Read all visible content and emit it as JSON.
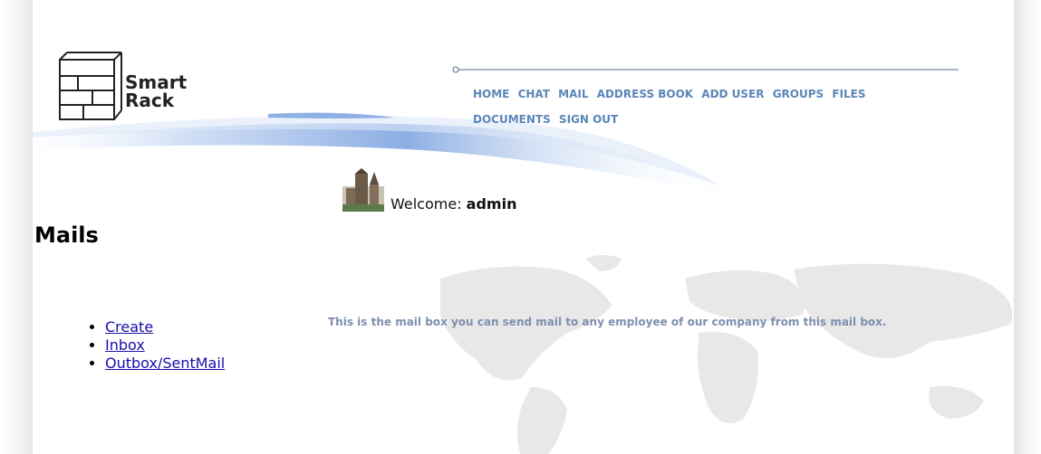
{
  "logo": {
    "line1": "Smart",
    "line2": "Rack"
  },
  "nav": {
    "items": [
      "HOME",
      "CHAT",
      "MAIL",
      "ADDRESS BOOK",
      "ADD USER",
      "GROUPS",
      "FILES",
      "DOCUMENTS",
      "SIGN OUT"
    ]
  },
  "welcome": {
    "label": "Welcome:",
    "user": "admin"
  },
  "heading": "Mails",
  "menu": {
    "items": [
      "Create",
      "Inbox",
      "Outbox/SentMail"
    ]
  },
  "description": "This is the mail box you can send mail to any employee of our company from this mail box.",
  "colors": {
    "nav": "#5b86b8",
    "description": "#7e8fb0",
    "link": "#1a0dab",
    "swoosh": "#7fa5e0"
  }
}
